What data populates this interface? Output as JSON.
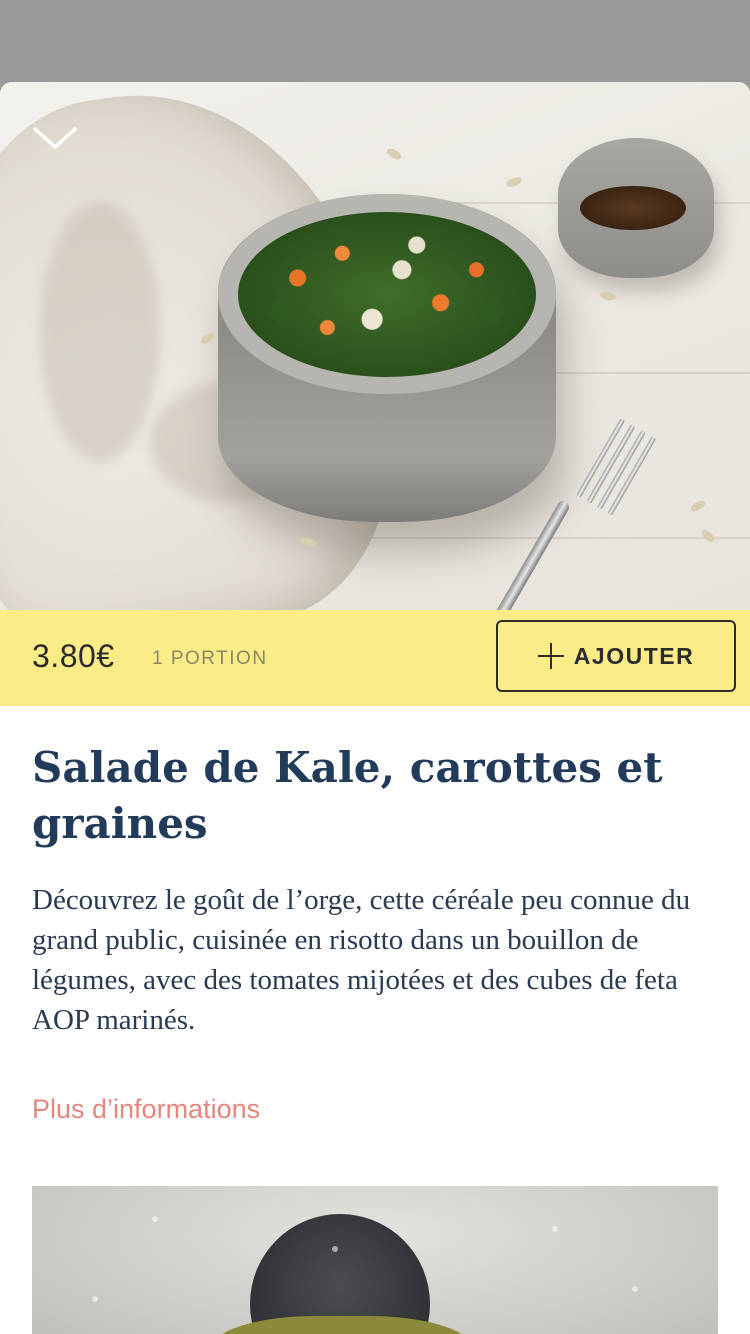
{
  "product": {
    "price": "3.80€",
    "portion": "1 PORTION",
    "add_label": "AJOUTER",
    "title": "Salade de Kale, carottes et graines",
    "description": "Découvrez le goût de l’orge, cette céréale peu connue du grand public, cuisinée en risotto dans un bouillon de légumes, avec des tomates mijotées et des cubes de feta AOP marinés.",
    "more_info": "Plus d’informations"
  },
  "icons": {
    "collapse": "chevron-down-icon",
    "add": "plus-icon"
  },
  "colors": {
    "overlay": "#9a9a9a",
    "price_bar": "#fcec88",
    "title": "#233b5a",
    "link": "#e8857c"
  }
}
